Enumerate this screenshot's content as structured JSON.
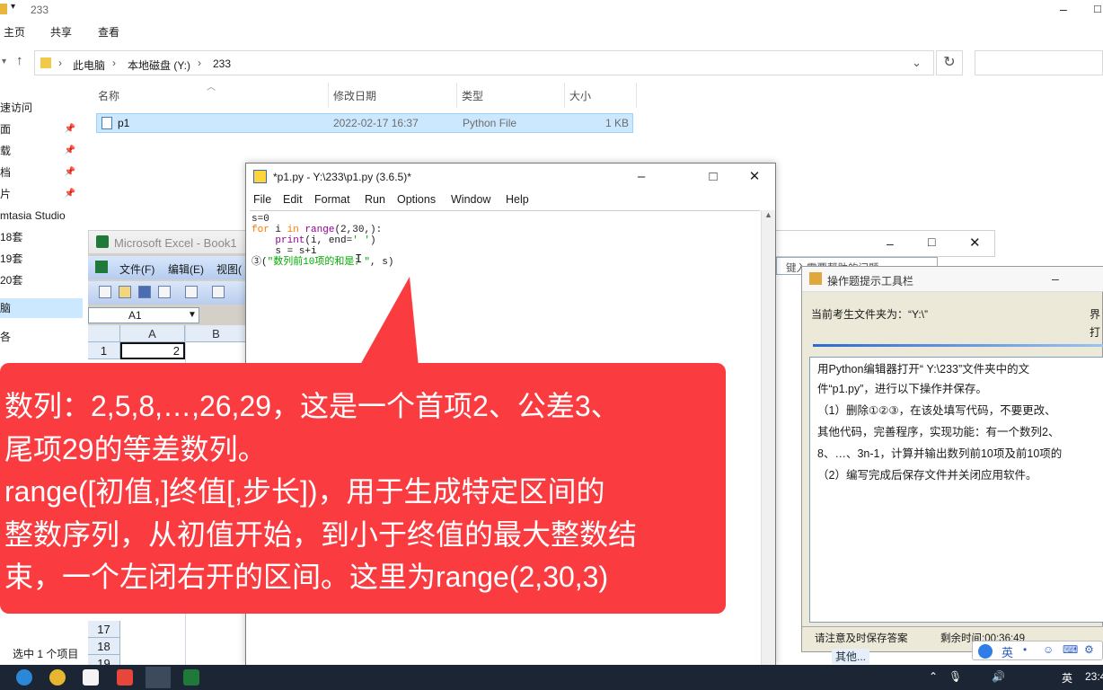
{
  "explorer": {
    "title": "233",
    "ribbon_tabs": [
      "主页",
      "共享",
      "查看"
    ],
    "breadcrumb": [
      "此电脑",
      "本地磁盘 (Y:)",
      "233"
    ],
    "columns": [
      "名称",
      "修改日期",
      "类型",
      "大小"
    ],
    "nav_items": [
      "速访问",
      "面",
      "载",
      "档",
      "片",
      "mtasia Studio",
      "18套",
      "19套",
      "20套",
      "脑",
      "各"
    ],
    "file": {
      "name": "p1",
      "modified": "2022-02-17 16:37",
      "type": "Python File",
      "size": "1 KB"
    },
    "status": "选中 1 个项目"
  },
  "excel": {
    "title": "Microsoft Excel - Book1",
    "menu": [
      "文件(F)",
      "编辑(E)",
      "视图("
    ],
    "cell_ref": "A1",
    "col_headers": [
      "A",
      "B"
    ],
    "rows": [
      {
        "n": "1",
        "a": "2"
      },
      {
        "n": "17",
        "a": ""
      },
      {
        "n": "18",
        "a": ""
      },
      {
        "n": "19",
        "a": ""
      }
    ]
  },
  "idle": {
    "title": "*p1.py - Y:\\233\\p1.py (3.6.5)*",
    "menu": [
      "File",
      "Edit",
      "Format",
      "Run",
      "Options",
      "Window",
      "Help"
    ],
    "code": {
      "l1": "s=0",
      "l2_kw1": "for",
      "l2_mid": " i ",
      "l2_kw2": "in",
      "l2_sp": " ",
      "l2_fn": "range",
      "l2_rest": "(2,30,):",
      "l3_fn": "print",
      "l3_a": "(i, end=",
      "l3_str": "' '",
      "l3_b": ")",
      "l4": "    s = s+i",
      "l5_a": "③(",
      "l5_str": "\"数列前10项的和是：\"",
      "l5_b": ", s)"
    }
  },
  "back_window": {
    "search_hint": "键入需要帮助的问题"
  },
  "hint": {
    "title": "操作题提示工具栏",
    "dir": "当前考生文件夹为：“Y:\\”",
    "right1": "界",
    "right2": "打",
    "lines": [
      "用Python编辑器打开“ Y:\\233”文件夹中的文",
      "件“p1.py”，进行以下操作并保存。",
      "（1）删除①②③，在该处填写代码，不要更改、",
      "其他代码，完善程序，实现功能：有一个数列2、",
      "8、…、3n-1，计算并输出数列前10项及前10项的",
      "（2）编写完成后保存文件并关闭应用软件。"
    ],
    "status_left": "请注意及时保存答案",
    "status_right": "剩余时间:00:36:49",
    "other": "其他..."
  },
  "callout": {
    "lines": [
      "数列：2,5,8,…,26,29，这是一个首项2、公差3、",
      "尾项29的等差数列。",
      "range([初值,]终值[,步长])，用于生成特定区间的",
      "整数序列，从初值开始，到小于终值的最大整数结",
      "束，一个左闭右开的区间。这里为range(2,30,3)"
    ]
  },
  "ime": {
    "label": "英"
  },
  "taskbar": {
    "lang": "英",
    "time": "23:4"
  }
}
